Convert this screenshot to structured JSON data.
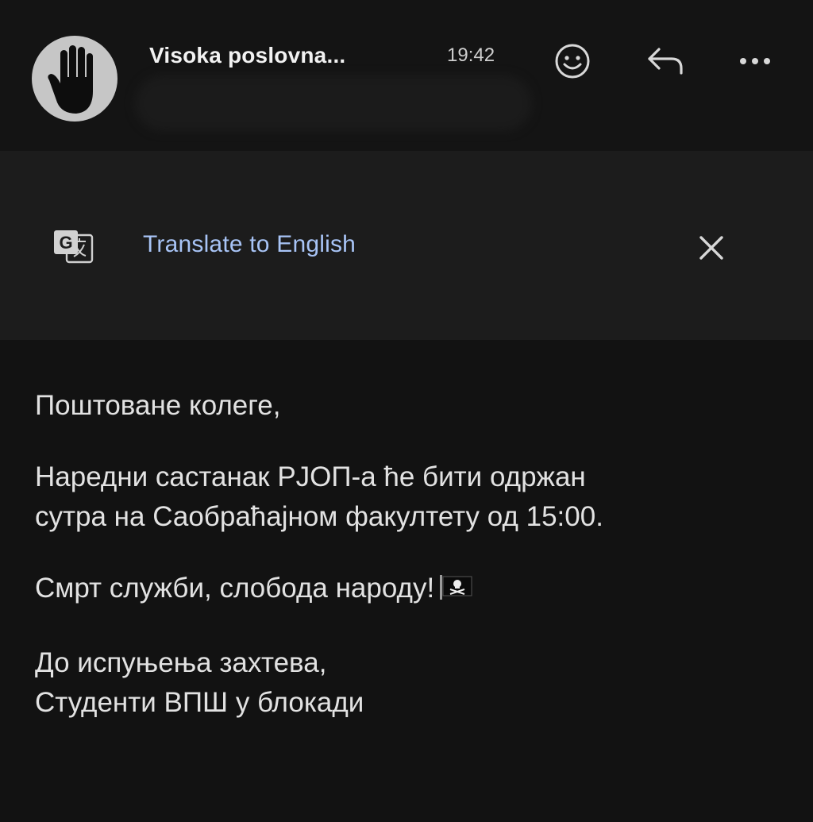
{
  "header": {
    "sender": "Visoka poslovna...",
    "time": "19:42",
    "icons": [
      "raised-hand-avatar",
      "emoji-reaction-icon",
      "reply-icon",
      "more-icon"
    ]
  },
  "translate_bar": {
    "label": "Translate to English",
    "icons": [
      "google-translate-icon",
      "close-icon"
    ]
  },
  "message": {
    "greeting": "Поштоване колеге,",
    "line1": "Наредни састанак РЈОП-а ће бити одржан",
    "line2": "сутра на Саобраћајном факултету од 15:00.",
    "slogan": "Смрт служби, слобода народу!",
    "slogan_emoji": "pirate-flag-emoji",
    "closing": "До испуњења захтева,",
    "signature": "Студенти ВПШ у блокади"
  },
  "colors": {
    "background": "#121212",
    "translate_bar": "#1c1c1c",
    "link": "#a8c4f6",
    "text": "#e2e2e2"
  }
}
